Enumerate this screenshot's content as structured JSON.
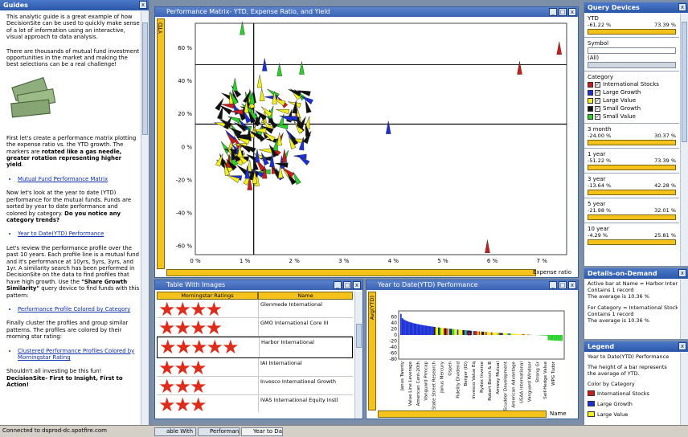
{
  "guides": {
    "title": "Guides",
    "p1": "This analytic guide is a great example of how DecisionSite can be used to quickly make sense of a lot of information using an interactive, visual approach to data analysis.",
    "p2": "There are thousands of mutual fund investment opportunities in the market and making the best selections can be a real challenge!",
    "p3a": "First let's create a performance matrix plotting the expense ratio vs. the YTD growth. The markers are ",
    "p3b": "rotated like a gas needle, greater rotation representing higher yield",
    "p3c": ".",
    "link1": "Mutual Fund Performance Matrix",
    "p4a": "Now let's look at the year to date (YTD) performance for the mutual funds. Funds are sorted by year to date performance and colored by category. ",
    "p4b": "Do you notice any category trends?",
    "link2": "Year to Date(YTD) Performance",
    "p5a": "Let's review the performance profile over the past 10 years. Each profile line is a mutual fund and it's performance at 10yrs, 5yrs, 3yrs, and 1yr. A similarity search has been performed in DecisionSite on the data to find profiles that have high growth. Use the ",
    "p5b": "\"Share Growth Similarity\"",
    "p5c": " query device to find funds with this pattern:",
    "link3": "Performance Profile Colored by Category",
    "p6": "Finally cluster the profiles and group similar patterns. The profiles are colored by their morning star rating:",
    "link4": "Clustered Performance Profiles Colored by Morningstar Rating",
    "p7a": "Shouldn't all investing be this fun! ",
    "p7b": "DecisionSite- First to Insight, First to Action!"
  },
  "matrix": {
    "title": "Performance Matrix- YTD, Expense Ratio, and Yield",
    "y_axis_label": "YTD",
    "x_axis_label": "Expense ratio"
  },
  "table": {
    "title": "Table With Images",
    "col1": "Morningstar Ratings",
    "col2": "Name",
    "rows": [
      {
        "stars": "★★★★",
        "name": "Glenmede International"
      },
      {
        "stars": "★★★★",
        "name": "GMO International Core III"
      },
      {
        "stars": "★★★★★",
        "name": "Harbor International"
      },
      {
        "stars": "★★★",
        "name": "IAI International"
      },
      {
        "stars": "★★★",
        "name": "Invesco International Growth"
      },
      {
        "stars": "★★★",
        "name": "IVAS International Equity Instl"
      }
    ]
  },
  "ytdpanel": {
    "title": "Year to Date(YTD) Performance",
    "y_axis_label": "Avg(YTD)",
    "x_axis_label": "Name",
    "fund_labels": [
      "Janus Twenty",
      "Value Line Leverage",
      "American Cent-20th",
      "Vanguard Prmcap",
      "State Street Research",
      "Janus Mercury",
      "Ospen",
      "Fidelity Dividend",
      "Berger (IO)",
      "Invesco Value Eq",
      "Rydex Inverse",
      "Robert Bench & B",
      "Amway Mutual",
      "Scudder Development",
      "American Advantage",
      "USAA International",
      "Vanguard Windsor",
      "Strong Gr",
      "Seif-Hedge Value",
      "WPG Tudor"
    ]
  },
  "query": {
    "title": "Query Devices",
    "ytd": {
      "label": "YTD",
      "min": "-61.22 %",
      "max": "73.39 %"
    },
    "symbol": {
      "label": "Symbol",
      "value": "(All)"
    },
    "category": {
      "label": "Category",
      "items": [
        "International Stocks",
        "Large Growth",
        "Large Value",
        "Small Growth",
        "Small Value"
      ]
    },
    "m3": {
      "label": "3 month",
      "min": "-24.00 %",
      "max": "30.37 %"
    },
    "y1": {
      "label": "1 year",
      "min": "-51.22 %",
      "max": "73.39 %"
    },
    "y3": {
      "label": "3 year",
      "min": "-13.64 %",
      "max": "42.28 %"
    },
    "y5": {
      "label": "5 year",
      "min": "-21.98 %",
      "max": "32.01 %"
    },
    "y10": {
      "label": "10 year",
      "min": "-4.29 %",
      "max": "25.81 %"
    }
  },
  "dod": {
    "title": "Details-on-Demand",
    "l1": "Active bar at Name = Harbor Internatio",
    "l2": "Contains 1 record",
    "l3": "The average is 10.36 %",
    "l4": "For Category = International Stocks",
    "l5": "Contains 1 record",
    "l6": "The average is 10.36 %"
  },
  "legend": {
    "title": "Legend",
    "l1": "Year to Date(YTD) Performance",
    "l2": "The height of a bar represents",
    "l3": "the average of YTD.",
    "l4": "Color by Category",
    "items": [
      "International Stocks",
      "Large Growth",
      "Large Value"
    ]
  },
  "status": {
    "text": "Connected to dsprod-dc.spotfire.com",
    "tabs": [
      "able With I...",
      "Performanc...",
      "Year to Dat..."
    ]
  },
  "colors": {
    "international": "#cc1b1b",
    "large_growth": "#1b2fd6",
    "large_value": "#f2ef1b",
    "small_growth": "#111111",
    "small_value": "#2ad12a",
    "slider": "#f4c21a"
  },
  "chart_data": [
    {
      "type": "scatter",
      "title": "Performance Matrix- YTD, Expense Ratio, and Yield",
      "xlabel": "Expense ratio",
      "ylabel": "YTD",
      "xlim": [
        0,
        7.5
      ],
      "ylim": [
        -65,
        75
      ],
      "x_ticks": [
        "0 %",
        "1 %",
        "2 %",
        "3 %",
        "4 %",
        "5 %",
        "6 %",
        "7 %"
      ],
      "y_ticks": [
        "60 %",
        "40 %",
        "20 %",
        "0 %",
        "-20 %",
        "-40 %",
        "-60 %"
      ],
      "grid": false,
      "series": [
        {
          "name": "International Stocks",
          "points": [
            [
              7.35,
              60
            ],
            [
              6.55,
              48
            ],
            [
              5.9,
              -60
            ],
            [
              1.8,
              -5
            ],
            [
              1.4,
              -15
            ],
            [
              1.1,
              -22
            ]
          ]
        },
        {
          "name": "Large Growth",
          "points": [
            [
              3.9,
              12
            ],
            [
              1.4,
              50
            ],
            [
              1.05,
              -15
            ],
            [
              1.55,
              -8
            ],
            [
              1.25,
              -5
            ]
          ]
        },
        {
          "name": "Large Value",
          "points": [
            [
              1.3,
              40
            ],
            [
              1.6,
              30
            ],
            [
              0.9,
              -2
            ],
            [
              1.7,
              5
            ],
            [
              1.2,
              -18
            ]
          ]
        },
        {
          "name": "Small Growth",
          "points": [
            [
              0.6,
              15
            ],
            [
              0.9,
              13
            ],
            [
              1.2,
              8
            ],
            [
              1.0,
              0
            ],
            [
              0.8,
              10
            ]
          ]
        },
        {
          "name": "Small Value",
          "points": [
            [
              0.95,
              72
            ],
            [
              1.7,
              47
            ],
            [
              2.15,
              48
            ],
            [
              0.8,
              38
            ],
            [
              1.15,
              30
            ]
          ]
        }
      ]
    },
    {
      "type": "bar",
      "title": "Year to Date(YTD) Performance",
      "xlabel": "Name",
      "ylabel": "Avg(YTD)",
      "ylim": [
        -80,
        80
      ],
      "y_ticks": [
        "60",
        "40",
        "20",
        "0",
        "-20",
        "-40",
        "-60",
        "-80"
      ],
      "bar_count": 120
    }
  ]
}
